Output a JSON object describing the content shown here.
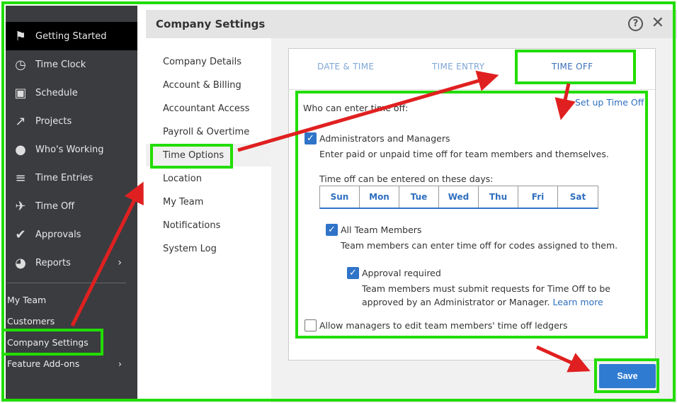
{
  "sidebar": {
    "items": [
      {
        "label": "Getting Started",
        "icon": "flag-icon"
      },
      {
        "label": "Time Clock",
        "icon": "clock-icon"
      },
      {
        "label": "Schedule",
        "icon": "calendar-icon"
      },
      {
        "label": "Projects",
        "icon": "trend-icon"
      },
      {
        "label": "Who's Working",
        "icon": "location-pin-icon"
      },
      {
        "label": "Time Entries",
        "icon": "list-clock-icon"
      },
      {
        "label": "Time Off",
        "icon": "airplane-icon"
      },
      {
        "label": "Approvals",
        "icon": "double-check-icon"
      },
      {
        "label": "Reports",
        "icon": "pie-chart-icon"
      }
    ],
    "links": [
      "My Team",
      "Customers",
      "Company Settings",
      "Feature Add-ons"
    ]
  },
  "modal": {
    "title": "Company Settings",
    "help": "?",
    "close": "✕",
    "nav": [
      "Company Details",
      "Account & Billing",
      "Accountant Access",
      "Payroll & Overtime",
      "Time Options",
      "Location",
      "My Team",
      "Notifications",
      "System Log"
    ],
    "tabs": [
      "DATE & TIME",
      "TIME ENTRY",
      "TIME OFF"
    ],
    "who_label": "Who can enter time off:",
    "setup_link": "Set up Time Off",
    "admins": {
      "label": "Administrators and Managers",
      "desc": "Enter paid or unpaid time off for team members and themselves.",
      "checked": true
    },
    "days_label": "Time off can be entered on these days:",
    "days": [
      "Sun",
      "Mon",
      "Tue",
      "Wed",
      "Thu",
      "Fri",
      "Sat"
    ],
    "team": {
      "label": "All Team Members",
      "desc": "Team members can enter time off for codes assigned to them.",
      "checked": true
    },
    "approval": {
      "label": "Approval required",
      "desc1": "Team members must submit requests for Time Off to be",
      "desc2": "approved by an Administrator or Manager.",
      "learn": "Learn more",
      "checked": true
    },
    "ledger": {
      "label": "Allow managers to edit team members' time off ledgers",
      "checked": false
    },
    "save": "Save"
  },
  "colors": {
    "highlight": "#22dd00",
    "arrow": "#e02020",
    "accent": "#2f74c8"
  }
}
